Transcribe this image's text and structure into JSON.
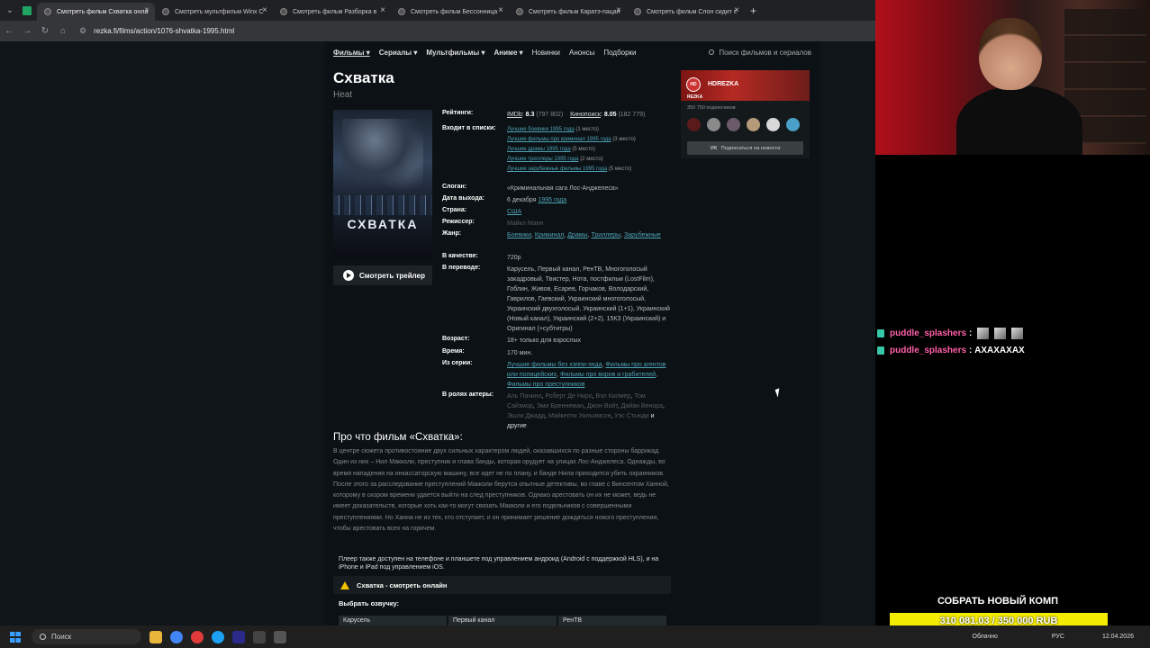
{
  "browser": {
    "tabs": [
      {
        "label": "Смотреть фильм Схватка онла"
      },
      {
        "label": "Смотреть мультфильм Winx C"
      },
      {
        "label": "Смотреть фильм Разборка в"
      },
      {
        "label": "Смотреть фильм Бессонница"
      },
      {
        "label": "Смотреть фильм Каратэ-пацан"
      },
      {
        "label": "Смотреть фильм Слон сидит с"
      }
    ],
    "url": "rezka.fi/films/action/1076-shvatka-1995.html"
  },
  "nav": {
    "items": [
      "Фильмы ▾",
      "Сериалы ▾",
      "Мультфильмы ▾",
      "Аниме ▾",
      "Новинки",
      "Анонсы",
      "Подборки"
    ],
    "search_placeholder": "Поиск фильмов и сериалов"
  },
  "film": {
    "title": "Схватка",
    "original_title": "Heat",
    "poster_title": "СХВАТКА",
    "trailer_label": "Смотреть трейлер",
    "labels": {
      "ratings": "Рейтинги:",
      "lists": "Входит в списки:",
      "slogan": "Слоган:",
      "release": "Дата выхода:",
      "country": "Страна:",
      "director": "Режиссер:",
      "genre": "Жанр:",
      "quality": "В качестве:",
      "translation": "В переводе:",
      "age": "Возраст:",
      "time": "Время:",
      "collection": "Из серии:",
      "actors": "В ролях актеры:"
    },
    "imdb_label": "IMDb",
    "imdb_score": "8.3",
    "imdb_votes": "(797 802)",
    "kp_label": "Кинопоиск",
    "kp_score": "8.05",
    "kp_votes": "(182 779)",
    "lists": [
      {
        "link": "Лучшие боевики 1995 года",
        "place": "(1 место)"
      },
      {
        "link": "Лучшие фильмы про криминал 1995 года",
        "place": "(3 место)"
      },
      {
        "link": "Лучшие драмы 1995 года",
        "place": "(5 место)"
      },
      {
        "link": "Лучшие триллеры 1995 года",
        "place": "(2 место)"
      },
      {
        "link": "Лучшие зарубежные фильмы 1995 года",
        "place": "(5 место)"
      }
    ],
    "slogan": "«Криминальная сага Лос-Анджелеса»",
    "release_day": "6 декабря",
    "release_year": "1995 года",
    "country": "США",
    "director": "Майкл Манн",
    "genres": [
      "Боевики",
      "Криминал",
      "Драмы",
      "Триллеры",
      "Зарубежные"
    ],
    "quality": "720p",
    "translation": "Карусель, Первый канал, РенТВ, Многоголосый закадровый, Твистер, Нота, постфильм (LostFilm), Гоблин, Живов, Есарев, Горчаков, Володарский, Гаврилов, Гаевский, Украинский многоголосый, Украинский двухголосый, Украинский (1+1), Украинский (Новый канал), Украинский (2+2), 15КЗ (Украинский) и Оригинал (+субтитры)",
    "age": "18+ только для взрослых",
    "time": "170 мин.",
    "collection": [
      "Лучшие фильмы без хэппи-энда",
      "Фильмы про агентов или полицейских",
      "Фильмы про воров и грабителей",
      "Фильмы про преступников"
    ],
    "actors": [
      "Аль Пачино",
      "Роберт Де Ниро",
      "Вэл Килмер",
      "Том Сайзмор",
      "Эми Бреннеман",
      "Джон Войт",
      "Дайан Венора",
      "Эшли Джадд",
      "Майкелти Уильямсон",
      "Уэс Стьюди"
    ],
    "actors_more": "и другие"
  },
  "sidebar": {
    "logo": "HD REZKA",
    "name": "HDREZKA",
    "subscribers": "350 750 подписчиков",
    "subscribe_label": "Подписаться на новости"
  },
  "about": {
    "heading": "Про что фильм «Схватка»:",
    "text": "В центре сюжета противостояние двух сильных характером людей, оказавшихся по разные стороны баррикад. Один из них – Нил Макколи, преступник и глава банды, которая орудует на улицах Лос-Анджелеса. Однажды, во время нападения на инкассаторскую машину, все идет не по плану, и банде Нила приходится убить охранников. После этого за расследование преступлений Макколи берутся опытные детективы, во главе с Винсентом Ханной, которому в скором времени удается выйти на след преступников. Однако арестовать он их не может, ведь не имеет доказательств, которые хоть как-то могут связать Макколи и его подельников с совершенными преступлениями. Но Ханна не из тех, кто отступает, и он принимает решение дождаться нового преступления, чтобы арестовать всех на горячем."
  },
  "player": {
    "note": "Плеер также доступен на телефоне и планшете под управлением андроид (Android с поддержкой HLS), и на iPhone и iPad под управлением iOS.",
    "title": "Схватка - смотреть онлайн",
    "dub_heading": "Выбрать озвучку:",
    "dubs": [
      "Карусель",
      "Первый канал",
      "РенТВ"
    ]
  },
  "stream": {
    "chat": [
      {
        "user": "puddle_splashers",
        "msg": ":"
      },
      {
        "user": "puddle_splashers",
        "msg": ": АХАХАХАХ"
      }
    ],
    "goal_title": "СОБРАТЬ НОВЫЙ КОМП",
    "goal_amount": "310 081.03 / 350 000 RUB",
    "goal_progress": 0.886
  },
  "taskbar": {
    "search": "Поиск",
    "weather": "Облачно",
    "lang": "РУС",
    "date": "12.04.2026"
  }
}
